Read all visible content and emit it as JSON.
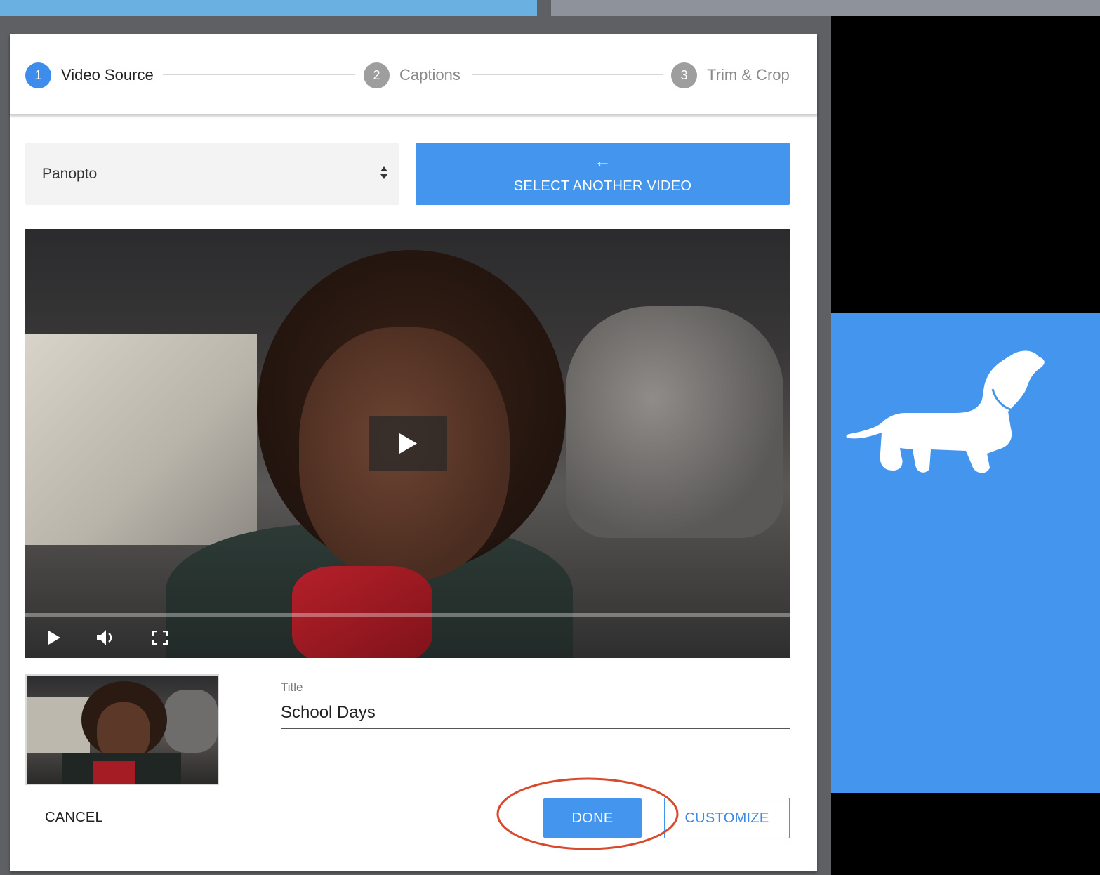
{
  "stepper": {
    "steps": [
      {
        "num": "1",
        "label": "Video Source"
      },
      {
        "num": "2",
        "label": "Captions"
      },
      {
        "num": "3",
        "label": "Trim & Crop"
      }
    ]
  },
  "source": {
    "selected": "Panopto"
  },
  "select_another": {
    "arrow": "←",
    "label": "SELECT ANOTHER VIDEO"
  },
  "video": {
    "play_icon": "play-icon",
    "volume_icon": "volume-icon",
    "fullscreen_icon": "fullscreen-icon"
  },
  "title_field": {
    "label": "Title",
    "value": "School Days"
  },
  "actions": {
    "cancel": "CANCEL",
    "done": "DONE",
    "customize": "CUSTOMIZE"
  },
  "colors": {
    "accent": "#4495ee",
    "annotation": "#d9492c"
  }
}
